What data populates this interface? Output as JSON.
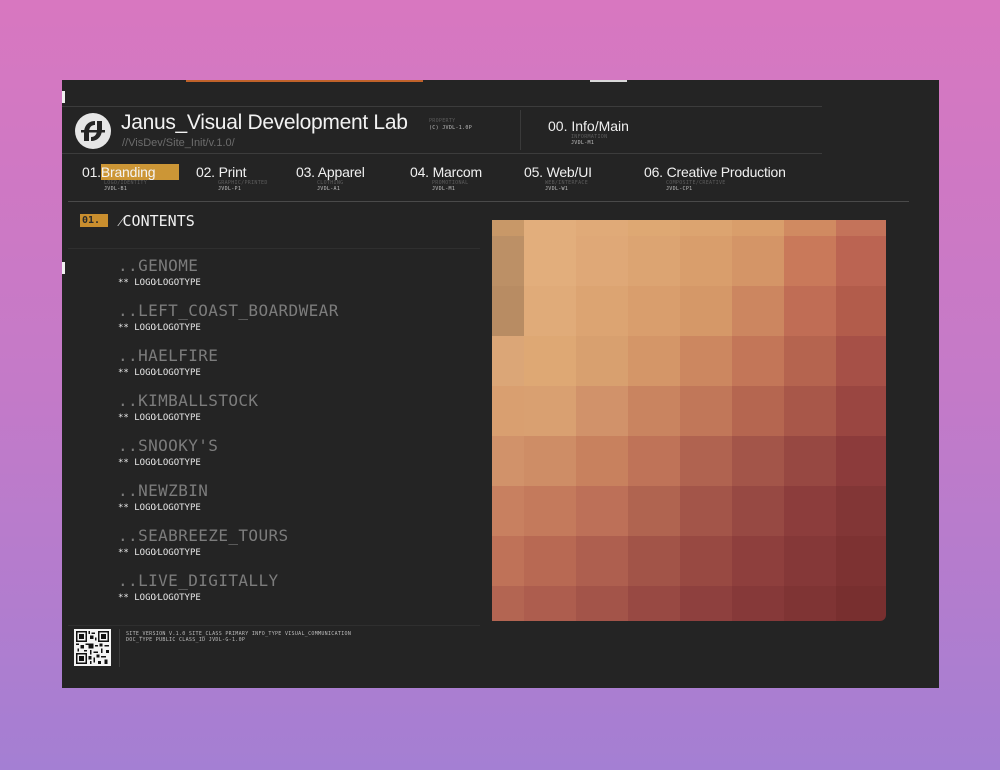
{
  "header": {
    "title": "Janus_Visual Development Lab",
    "subtitle": "//VisDev/Site_Init/v.1.0/",
    "meta_label": "PROPERTY",
    "meta_value": "(C) JVDL-1.0P",
    "info_main": "00. Info/Main",
    "info_sub_label": "INFORMATION",
    "info_sub_code": "JVDL-M1"
  },
  "nav": [
    {
      "num": "01.",
      "label": "Branding",
      "sub": "LOGO/IDENTITY",
      "code": "JVDL-B1",
      "active": true
    },
    {
      "num": "02.",
      "label": "Print",
      "sub": "GRAPHIC/PRINTED",
      "code": "JVDL-P1"
    },
    {
      "num": "03.",
      "label": "Apparel",
      "sub": "CLOTHING",
      "code": "JVDL-A1"
    },
    {
      "num": "04.",
      "label": "Marcom",
      "sub": "PROMOTIONAL",
      "code": "JVDL-M1"
    },
    {
      "num": "05.",
      "label": "Web/UI",
      "sub": "WEB/INTERFACE",
      "code": "JVDL-W1"
    },
    {
      "num": "06.",
      "label": "Creative Production",
      "sub": "COMPOSITE/CREATIVE",
      "code": "JVDL-CP1"
    }
  ],
  "section": {
    "number": "01.",
    "title": "⁄CONTENTS"
  },
  "contents": [
    {
      "name": "..GENOME",
      "tag": "** LOGO⁄LOGOTYPE"
    },
    {
      "name": "..LEFT_COAST_BOARDWEAR",
      "tag": "** LOGO⁄LOGOTYPE"
    },
    {
      "name": "..HAELFIRE",
      "tag": "** LOGO⁄LOGOTYPE"
    },
    {
      "name": "..KIMBALLSTOCK",
      "tag": "** LOGO⁄LOGOTYPE"
    },
    {
      "name": "..SNOOKY'S",
      "tag": "** LOGO⁄LOGOTYPE"
    },
    {
      "name": "..NEWZBIN",
      "tag": "** LOGO⁄LOGOTYPE"
    },
    {
      "name": "..SEABREEZE_TOURS",
      "tag": "** LOGO⁄LOGOTYPE"
    },
    {
      "name": "..LIVE_DIGITALLY",
      "tag": "** LOGO⁄LOGOTYPE"
    }
  ],
  "mosaic": {
    "columns": 8,
    "rows": 8,
    "colors": [
      [
        "#c89868",
        "#e2ae7c",
        "#e0aa78",
        "#dea873",
        "#dca470",
        "#d99e6b",
        "#d08a61",
        "#c4735a"
      ],
      [
        "#bc9066",
        "#e2ae7c",
        "#dfa877",
        "#dca472",
        "#d99e6c",
        "#d49567",
        "#c9795a",
        "#bb6452"
      ],
      [
        "#b88c63",
        "#e0ab79",
        "#dca472",
        "#d99e6d",
        "#d59868",
        "#cc8660",
        "#c06d55",
        "#b25c4b"
      ],
      [
        "#dba677",
        "#dea874",
        "#d8a06f",
        "#d49668",
        "#cc8760",
        "#c37658",
        "#b5644f",
        "#a65047"
      ],
      [
        "#d99f70",
        "#d9a071",
        "#d1926a",
        "#c98460",
        "#c17759",
        "#b56650",
        "#a85749",
        "#9a4641"
      ],
      [
        "#d1926a",
        "#ce8d66",
        "#c8815e",
        "#bf7358",
        "#b06350",
        "#a35549",
        "#974842",
        "#8c3b3b"
      ],
      [
        "#c88060",
        "#c47a5c",
        "#bd7058",
        "#b06450",
        "#a35549",
        "#974943",
        "#8c3d3c",
        "#823636"
      ],
      [
        "#bf7258",
        "#b86953",
        "#ae5f4f",
        "#a25448",
        "#984942",
        "#8e3f3d",
        "#853838",
        "#7d3232"
      ],
      [
        "#b36552",
        "#ad5d4e",
        "#a35449",
        "#984943",
        "#8e403e",
        "#863939",
        "#7f3434",
        "#782f2f"
      ]
    ]
  },
  "footer": {
    "line1": [
      {
        "k": "SITE_VERSION",
        "v": "V.1.0"
      },
      {
        "k": "SITE_CLASS",
        "v": "PRIMARY"
      },
      {
        "k": "INFO_TYPE",
        "v": "VISUAL_COMMUNICATION"
      }
    ],
    "line2": [
      {
        "k": "DOC_TYPE",
        "v": "PUBLIC"
      },
      {
        "k": "CLASS_ID",
        "v": "JVDL-G-1.0P"
      }
    ]
  }
}
